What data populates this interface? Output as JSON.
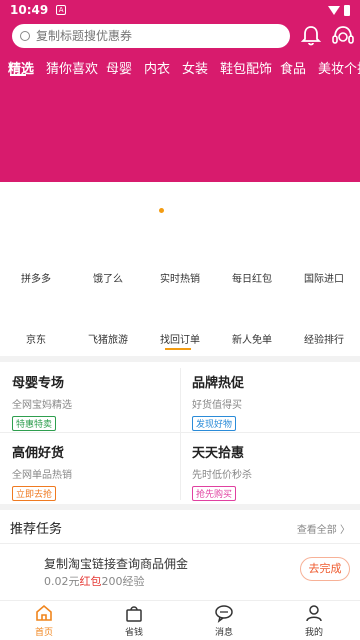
{
  "status_bar": {
    "time": "10:49",
    "notification_badge": "A"
  },
  "search": {
    "placeholder": "复制标题搜优惠券"
  },
  "category_tabs": [
    "精选",
    "猜你喜欢",
    "母婴",
    "内衣",
    "女装",
    "鞋包配饰",
    "食品",
    "美妆个护"
  ],
  "active_category": "精选",
  "shortcuts_row1": [
    "拼多多",
    "饿了么",
    "实时热销",
    "每日红包",
    "国际进口"
  ],
  "shortcuts_row2": [
    "京东",
    "飞猪旅游",
    "找回订单",
    "新人免单",
    "经验排行"
  ],
  "promos": [
    {
      "title": "母婴专场",
      "subtitle": "全网宝妈精选",
      "tag": "特惠特卖"
    },
    {
      "title": "品牌热促",
      "subtitle": "好货值得买",
      "tag": "发现好物"
    },
    {
      "title": "高佣好货",
      "subtitle": "全网单品热销",
      "tag": "立即去抢"
    },
    {
      "title": "天天拾惠",
      "subtitle": "先时低价秒杀",
      "tag": "抢先购买"
    }
  ],
  "tasks": {
    "title": "推荐任务",
    "view_all": "查看全部 〉",
    "items": [
      {
        "name": "复制淘宝链接查询商品佣金",
        "reward_prefix": "0.02元",
        "reward_red": "红包",
        "reward_suffix": "200经验",
        "button": "去完成"
      }
    ]
  },
  "bottom_nav": [
    {
      "label": "首页",
      "icon": "home-icon",
      "active": true
    },
    {
      "label": "省钱",
      "icon": "bag-icon",
      "active": false
    },
    {
      "label": "消息",
      "icon": "chat-icon",
      "active": false
    },
    {
      "label": "我的",
      "icon": "user-icon",
      "active": false
    }
  ],
  "colors": {
    "brand": "#d81b6d",
    "accent": "#f0851d"
  }
}
